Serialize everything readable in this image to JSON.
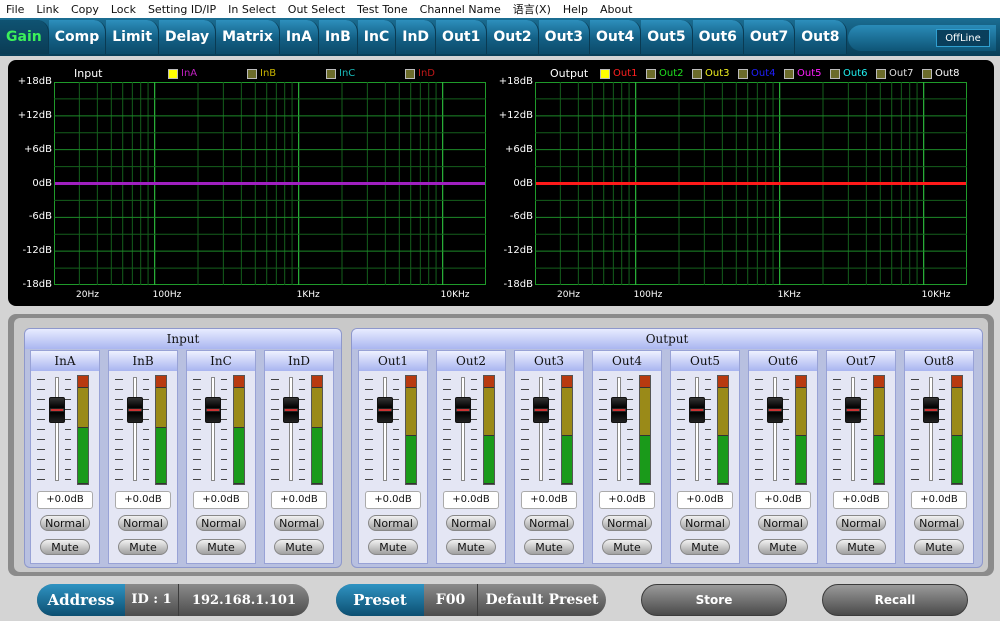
{
  "menu": [
    "File",
    "Link",
    "Copy",
    "Lock",
    "Setting ID/IP",
    "In Select",
    "Out Select",
    "Test Tone",
    "Channel Name",
    "语言(X)",
    "Help",
    "About"
  ],
  "tabs": [
    {
      "label": "Gain",
      "active": true
    },
    {
      "label": "Comp"
    },
    {
      "label": "Limit"
    },
    {
      "label": "Delay"
    },
    {
      "label": "Matrix"
    },
    {
      "label": "InA"
    },
    {
      "label": "InB"
    },
    {
      "label": "InC"
    },
    {
      "label": "InD"
    },
    {
      "label": "Out1"
    },
    {
      "label": "Out2"
    },
    {
      "label": "Out3"
    },
    {
      "label": "Out4"
    },
    {
      "label": "Out5"
    },
    {
      "label": "Out6"
    },
    {
      "label": "Out7"
    },
    {
      "label": "Out8"
    }
  ],
  "status": {
    "label": "OffLine"
  },
  "input_graph": {
    "title": "Input",
    "legend": [
      {
        "label": "InA",
        "color": "#c020c0",
        "checked": true
      },
      {
        "label": "InB",
        "color": "#c8b400",
        "checked": false
      },
      {
        "label": "InC",
        "color": "#18b8b8",
        "checked": false
      },
      {
        "label": "InD",
        "color": "#c01818",
        "checked": false
      }
    ],
    "trace_color": "#a020c0"
  },
  "output_graph": {
    "title": "Output",
    "legend": [
      {
        "label": "Out1",
        "color": "#ff2020",
        "checked": true
      },
      {
        "label": "Out2",
        "color": "#20e020",
        "checked": false
      },
      {
        "label": "Out3",
        "color": "#f0f020",
        "checked": false
      },
      {
        "label": "Out4",
        "color": "#2020ff",
        "checked": false
      },
      {
        "label": "Out5",
        "color": "#ff20ff",
        "checked": false
      },
      {
        "label": "Out6",
        "color": "#20f0f0",
        "checked": false
      },
      {
        "label": "Out7",
        "color": "#e0e0e0",
        "checked": false
      },
      {
        "label": "Out8",
        "color": "#ffffff",
        "checked": false
      }
    ],
    "trace_color": "#ff1a1a"
  },
  "y_ticks": [
    "+18dB",
    "+12dB",
    "+6dB",
    "0dB",
    "-6dB",
    "-12dB",
    "-18dB"
  ],
  "x_ticks": [
    "20Hz",
    "100Hz",
    "1KHz",
    "10KHz"
  ],
  "mixer": {
    "input_title": "Input",
    "output_title": "Output",
    "inputs": [
      {
        "name": "InA",
        "value": "+0.0dB",
        "mode": "Normal",
        "mute": "Mute"
      },
      {
        "name": "InB",
        "value": "+0.0dB",
        "mode": "Normal",
        "mute": "Mute"
      },
      {
        "name": "InC",
        "value": "+0.0dB",
        "mode": "Normal",
        "mute": "Mute"
      },
      {
        "name": "InD",
        "value": "+0.0dB",
        "mode": "Normal",
        "mute": "Mute"
      }
    ],
    "outputs": [
      {
        "name": "Out1",
        "value": "+0.0dB",
        "mode": "Normal",
        "mute": "Mute"
      },
      {
        "name": "Out2",
        "value": "+0.0dB",
        "mode": "Normal",
        "mute": "Mute"
      },
      {
        "name": "Out3",
        "value": "+0.0dB",
        "mode": "Normal",
        "mute": "Mute"
      },
      {
        "name": "Out4",
        "value": "+0.0dB",
        "mode": "Normal",
        "mute": "Mute"
      },
      {
        "name": "Out5",
        "value": "+0.0dB",
        "mode": "Normal",
        "mute": "Mute"
      },
      {
        "name": "Out6",
        "value": "+0.0dB",
        "mode": "Normal",
        "mute": "Mute"
      },
      {
        "name": "Out7",
        "value": "+0.0dB",
        "mode": "Normal",
        "mute": "Mute"
      },
      {
        "name": "Out8",
        "value": "+0.0dB",
        "mode": "Normal",
        "mute": "Mute"
      }
    ]
  },
  "bottom": {
    "address_label": "Address",
    "id": "ID : 1",
    "ip": "192.168.1.101",
    "preset_label": "Preset",
    "preset_code": "F00",
    "preset_name": "Default Preset",
    "store": "Store",
    "recall": "Recall"
  }
}
